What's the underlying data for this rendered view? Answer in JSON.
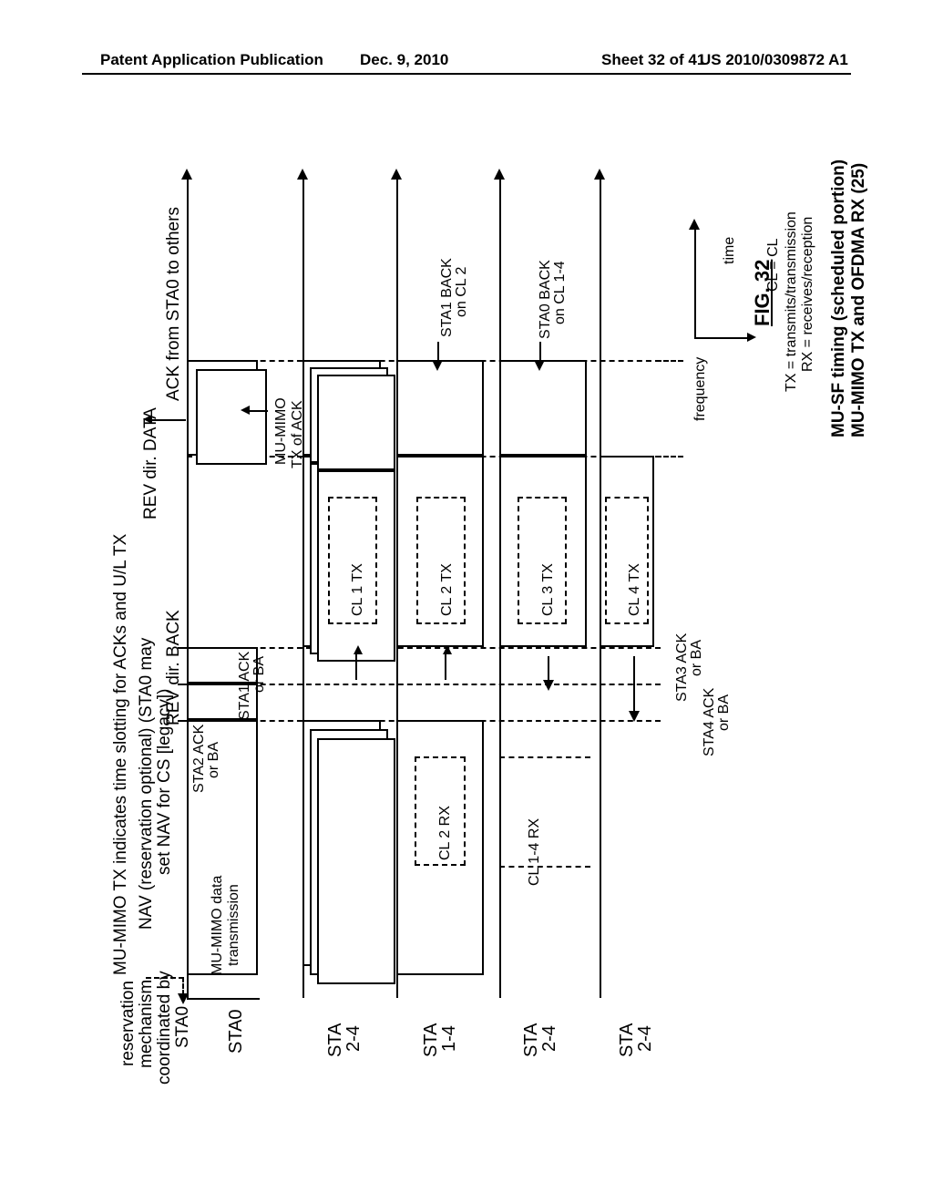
{
  "header": {
    "left": "Patent Application Publication",
    "center": "Dec. 9, 2010",
    "right": "Sheet 32 of 41",
    "pubnum": "US 2010/0309872 A1"
  },
  "top_notes": {
    "line1": "MU-MIMO TX indicates time slotting for ACKs and U/L TX",
    "line2": "NAV (reservation optional) (STA0 may",
    "line3": "set NAV for CS [legacy])",
    "reservation_a": "reservation",
    "reservation_b": "mechanism",
    "reservation_c": "coordinated by",
    "reservation_d": "STA0",
    "rev_back": "REV dir. BACK",
    "rev_data": "REV dir. DATA",
    "ack_others": "ACK from STA0 to others"
  },
  "lane_labels": {
    "sta0": "STA0",
    "sta24a": "STA\n2-4",
    "sta14": "STA\n1-4",
    "sta24b": "STA\n2-4",
    "sta24c": "STA\n2-4"
  },
  "sta0": {
    "data_a": "MU-MIMO data",
    "data_b": "transmission",
    "sta2_a": "STA2 ACK",
    "sta2_b": "or BA",
    "sta1_a": "STA1 ACK",
    "sta1_b": "or BA",
    "mumimo_ack_a": "MU-MIMO",
    "mumimo_ack_b": "TX of ACK"
  },
  "rx": {
    "cl2": "CL 2 RX",
    "cl14": "CL 1-4 RX"
  },
  "tx": {
    "cl1": "CL 1 TX",
    "cl2": "CL 2 TX",
    "cl3": "CL 3 TX",
    "cl4": "CL 4 TX",
    "sta3_a": "STA3 ACK",
    "sta3_b": "or BA",
    "sta4_a": "STA4 ACK",
    "sta4_b": "or BA"
  },
  "backs": {
    "sta1_a": "STA1 BACK",
    "sta1_b": "on CL 2",
    "sta0_a": "STA0 BACK",
    "sta0_b": "on CL 1-4"
  },
  "axes": {
    "freq": "frequency",
    "time": "time"
  },
  "legend": {
    "cl": "CL = CL",
    "tx": "TX = transmits/transmission",
    "rx": "RX = receives/reception"
  },
  "caption": {
    "a": "MU-SF timing (scheduled portion)",
    "b": "MU-MIMO TX and OFDMA RX (25)"
  },
  "fig": "FIG. 32"
}
